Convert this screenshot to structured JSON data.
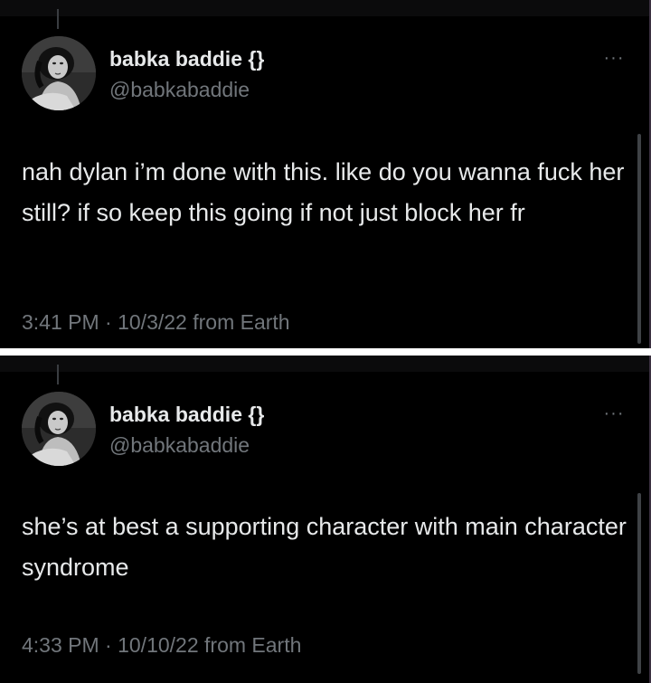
{
  "tweets": [
    {
      "display_name": "babka baddie {}",
      "handle": "@babkabaddie",
      "more_label": "···",
      "text": "nah dylan i’m done with this. like do you wanna fuck her still? if so keep this going if not just block her fr",
      "meta": "3:41 PM · 10/3/22 from Earth",
      "avatar_icon": "profile-photo-vintage-woman"
    },
    {
      "display_name": "babka baddie {}",
      "handle": "@babkabaddie",
      "more_label": "···",
      "text": "she’s at best a supporting character with main character syndrome",
      "meta": "4:33 PM · 10/10/22 from Earth",
      "avatar_icon": "profile-photo-vintage-woman"
    }
  ],
  "colors": {
    "background": "#000000",
    "primary_text": "#e7e9ea",
    "secondary_text": "#71767b",
    "divider": "#ffffff"
  }
}
